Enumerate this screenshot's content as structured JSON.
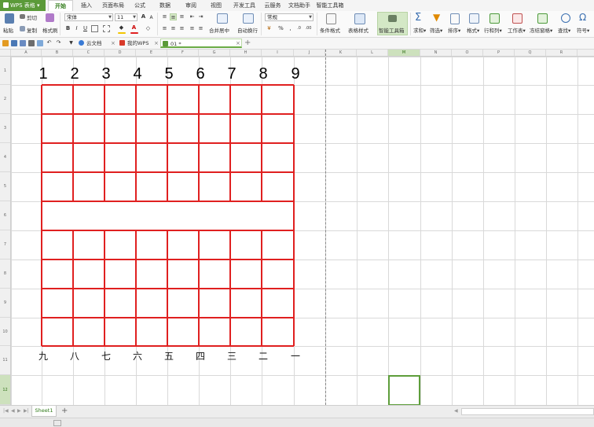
{
  "menubar": {
    "app_title": "WPS 表格",
    "tabs": [
      "开始",
      "插入",
      "页面布局",
      "公式",
      "数据",
      "审阅",
      "视图",
      "开发工具",
      "云服务",
      "文档助手",
      "智能工具箱"
    ]
  },
  "ribbon": {
    "paste": "粘贴",
    "cut": "剪切",
    "copy": "复制",
    "format_painter": "格式刷",
    "font_name": "宋体",
    "font_size": "11",
    "merge_center": "合并居中",
    "wrap_text": "自动换行",
    "number_format": "常规",
    "conditional_format": "条件格式",
    "table_style": "表格样式",
    "smart_toolbox": "智能工具箱",
    "sum": "求和",
    "filter": "筛选",
    "sort": "排序",
    "format": "格式",
    "row_col": "行和列",
    "worksheet": "工作表",
    "freeze": "冻结窗格",
    "find": "查找",
    "symbol": "符号",
    "bold": "B",
    "italic": "I",
    "underline": "U",
    "percent": "%"
  },
  "doc_tabs": [
    {
      "label": "云文档"
    },
    {
      "label": "我的WPS"
    },
    {
      "label": "01 *"
    }
  ],
  "columns": [
    "A",
    "B",
    "C",
    "D",
    "E",
    "F",
    "G",
    "H",
    "I",
    "J",
    "K",
    "L",
    "M",
    "N",
    "O",
    "P",
    "Q",
    "R"
  ],
  "selected_column": "M",
  "rows": [
    "1",
    "2",
    "3",
    "4",
    "5",
    "6",
    "7",
    "8",
    "9",
    "10",
    "11",
    "12"
  ],
  "selected_row": "12",
  "board": {
    "top_numbers": [
      "1",
      "2",
      "3",
      "4",
      "5",
      "6",
      "7",
      "8",
      "9"
    ],
    "bottom_numbers": [
      "九",
      "八",
      "七",
      "六",
      "五",
      "四",
      "三",
      "二",
      "一"
    ],
    "line_color": "#e02020"
  },
  "sheet_tab": "Sheet1",
  "colors": {
    "accent": "#5b9a39",
    "grid": "#d9d9d9"
  }
}
